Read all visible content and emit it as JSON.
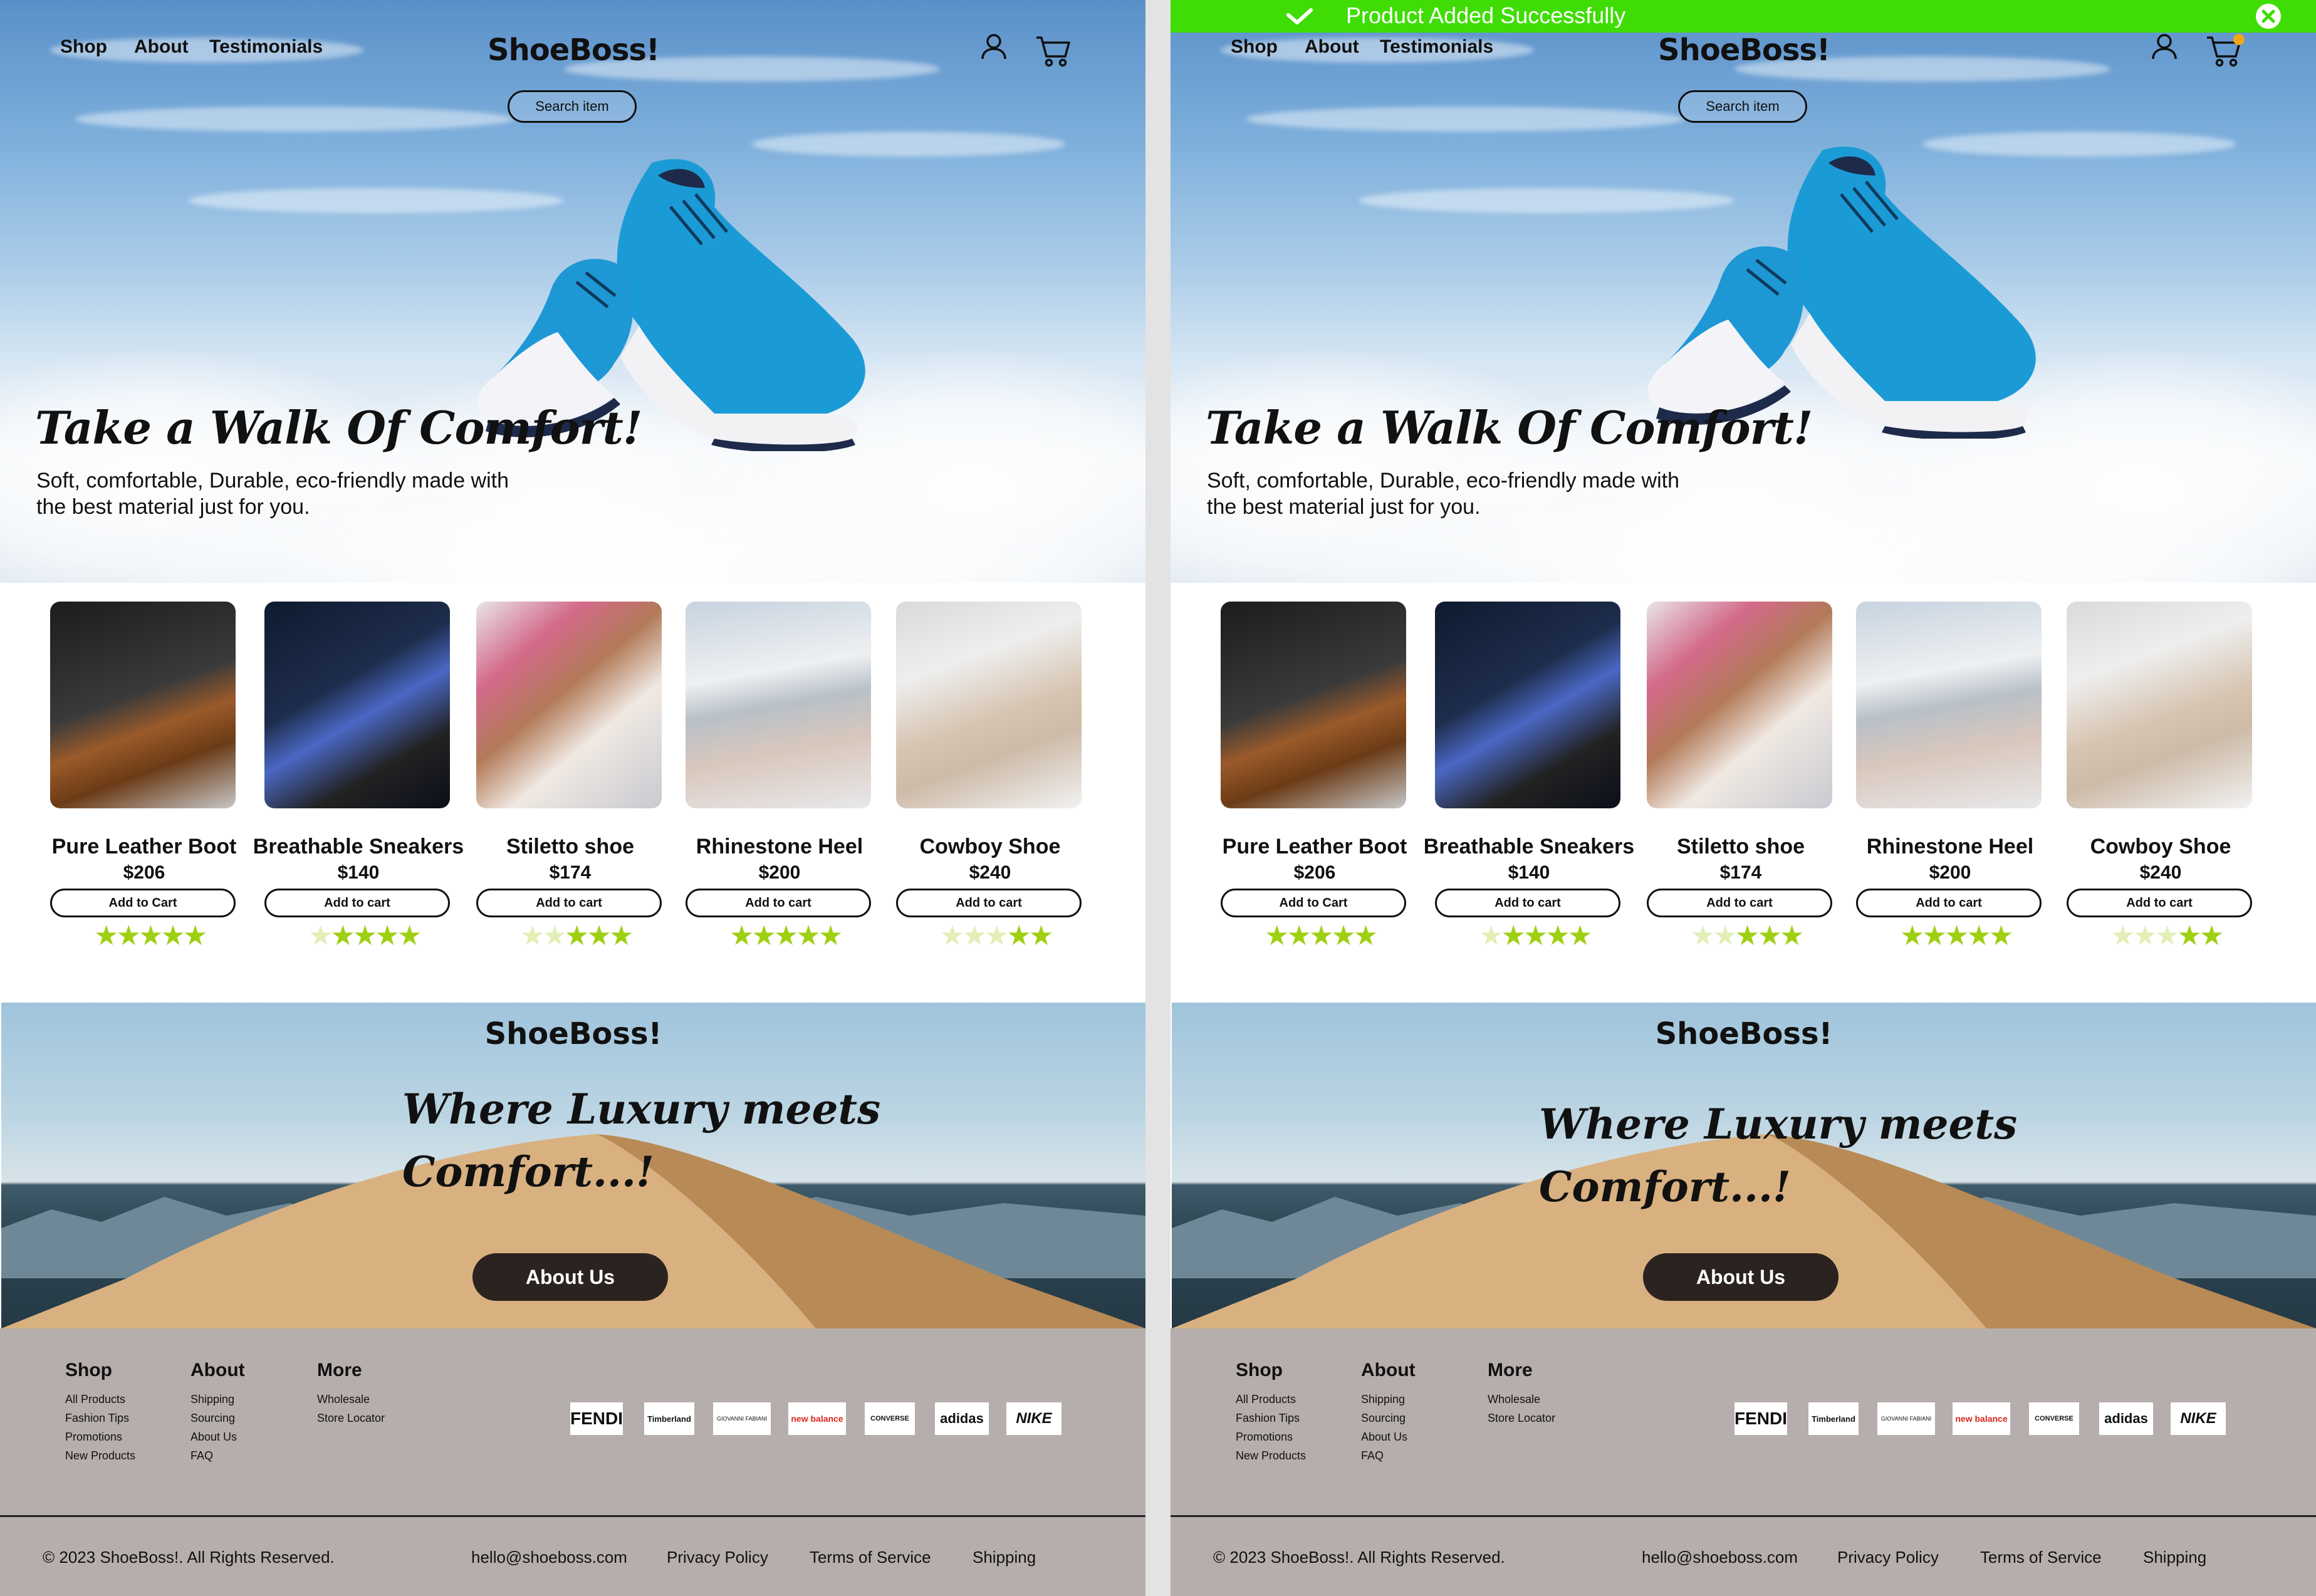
{
  "nav": {
    "shop": "Shop",
    "about": "About",
    "testimonials": "Testimonials"
  },
  "brand": "ShoeBoss!",
  "search": {
    "label": "Search item"
  },
  "hero": {
    "title": "Take a Walk Of Comfort!",
    "subtitle_line1": "Soft, comfortable, Durable, eco-friendly made with",
    "subtitle_line2": "the best material just for you."
  },
  "products": [
    {
      "name": "Pure Leather Boot",
      "price": "$206",
      "button": "Add to Cart",
      "rating": 5
    },
    {
      "name": "Breathable Sneakers",
      "price": "$140",
      "button": "Add to cart",
      "rating": 4
    },
    {
      "name": "Stiletto shoe",
      "price": "$174",
      "button": "Add to cart",
      "rating": 3
    },
    {
      "name": "Rhinestone Heel",
      "price": "$200",
      "button": "Add to cart",
      "rating": 5
    },
    {
      "name": "Cowboy Shoe",
      "price": "$240",
      "button": "Add to cart",
      "rating": 2
    }
  ],
  "banner": {
    "brand": "ShoeBoss!",
    "tagline_line1": "Where Luxury meets",
    "tagline_line2": "Comfort...!",
    "button": "About Us"
  },
  "footer": {
    "cols": [
      {
        "heading": "Shop",
        "links": [
          "All Products",
          "Fashion Tips",
          "Promotions",
          "New Products"
        ]
      },
      {
        "heading": "About",
        "links": [
          "Shipping",
          "Sourcing",
          "About Us",
          "FAQ"
        ]
      },
      {
        "heading": "More",
        "links": [
          "Wholesale",
          "Store Locator"
        ]
      }
    ],
    "brands": [
      "FENDI",
      "Timberland",
      "GIOVANNI FABIANI",
      "new balance",
      "CONVERSE",
      "adidas",
      "NIKE"
    ],
    "copyright": "2023 ShoeBoss!. All Rights Reserved.",
    "email": "hello@shoeboss.com",
    "privacy": "Privacy Policy",
    "terms": "Terms of Service",
    "shipping": "Shipping"
  },
  "toast": {
    "message": "Product Added Successfully"
  },
  "colors": {
    "toast": "#3fdd05",
    "star": "#9ed012",
    "footer": "#b6aeac",
    "button_dark": "#2b2320"
  }
}
